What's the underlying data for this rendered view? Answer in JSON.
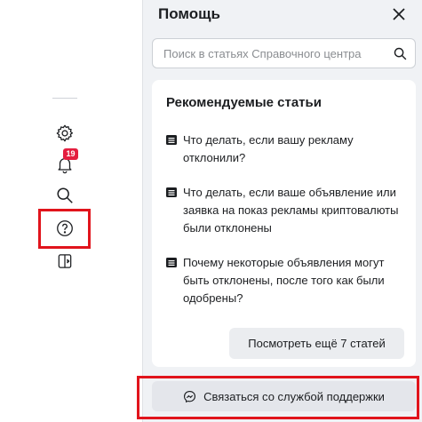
{
  "rail": {
    "notifications_badge": "19"
  },
  "panel": {
    "title": "Помощь",
    "search_placeholder": "Поиск в статьях Справочного центра",
    "recommended": {
      "heading": "Рекомендуемые статьи",
      "articles": [
        "Что делать, если вашу рекламу отклонили?",
        "Что делать, если ваше объявление или заявка на показ рекламы криптовалюты были отклонены",
        "Почему некоторые объявления могут быть отклонены, после того как были одобрены?"
      ],
      "more_label": "Посмотреть ещё 7 статей"
    },
    "support_label": "Связаться со службой поддержки"
  },
  "colors": {
    "highlight": "#e1141c",
    "badge": "#e41e3f",
    "panel_bg": "#f0f2f5"
  },
  "icons": [
    "gear-icon",
    "bell-icon",
    "search-icon",
    "help-icon",
    "panel-toggle-icon",
    "close-icon",
    "document-icon",
    "messenger-icon"
  ]
}
